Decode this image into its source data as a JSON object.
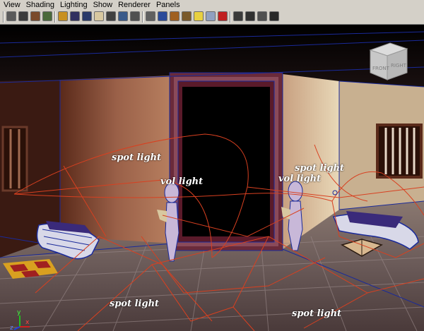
{
  "menu": [
    "View",
    "Shading",
    "Lighting",
    "Show",
    "Renderer",
    "Panels"
  ],
  "toolbar": {
    "buttons": [
      {
        "icon": "select-camera-icon",
        "color": "#5a5a5a"
      },
      {
        "icon": "camera-attributes-icon",
        "color": "#3b3b3b"
      },
      {
        "icon": "bookmark-icon",
        "color": "#7a4a2a"
      },
      {
        "icon": "image-plane-icon",
        "color": "#4a6a3a"
      },
      {
        "icon": "grid-icon",
        "color": "#c89020"
      },
      {
        "icon": "film-gate-icon",
        "color": "#303060"
      },
      {
        "icon": "resolution-gate-icon",
        "color": "#2a3a6a"
      },
      {
        "icon": "gate-mask-icon",
        "color": "#d8c8a0"
      },
      {
        "icon": "field-chart-icon",
        "color": "#404040"
      },
      {
        "icon": "safe-action-icon",
        "color": "#3a5a8a"
      },
      {
        "icon": "safe-title-icon",
        "color": "#505050"
      },
      {
        "icon": "wireframe-icon",
        "color": "#606060"
      },
      {
        "icon": "smooth-shade-icon",
        "color": "#2a4a9a"
      },
      {
        "icon": "default-material-icon",
        "color": "#a06020"
      },
      {
        "icon": "textured-icon",
        "color": "#7a5a2a"
      },
      {
        "icon": "use-all-lights-icon",
        "color": "#e8d040"
      },
      {
        "icon": "shadows-icon",
        "color": "#90a0c0"
      },
      {
        "icon": "hardware-texture-icon",
        "color": "#c02020"
      },
      {
        "icon": "xray-icon",
        "color": "#3a3a3a"
      },
      {
        "icon": "isolate-select-icon",
        "color": "#303030"
      },
      {
        "icon": "high-quality-icon",
        "color": "#505050"
      },
      {
        "icon": "resolution-icon",
        "color": "#282828"
      }
    ]
  },
  "viewcube": {
    "front": "FRONT",
    "right": "RIGHT"
  },
  "labels": {
    "spot1": "spot light",
    "spot2": "spot light",
    "vol1": "vol light",
    "vol2": "vol light",
    "spot3": "spot light",
    "spot4": "spot light"
  },
  "axis": {
    "y": "y",
    "z": "z",
    "x": "x"
  },
  "colors": {
    "light_wire": "#d84020",
    "selection_blue": "#1a2a9a",
    "room_wall": "#9a6048",
    "floor": "#7a6a60",
    "door_frame": "#6a2a3a"
  }
}
